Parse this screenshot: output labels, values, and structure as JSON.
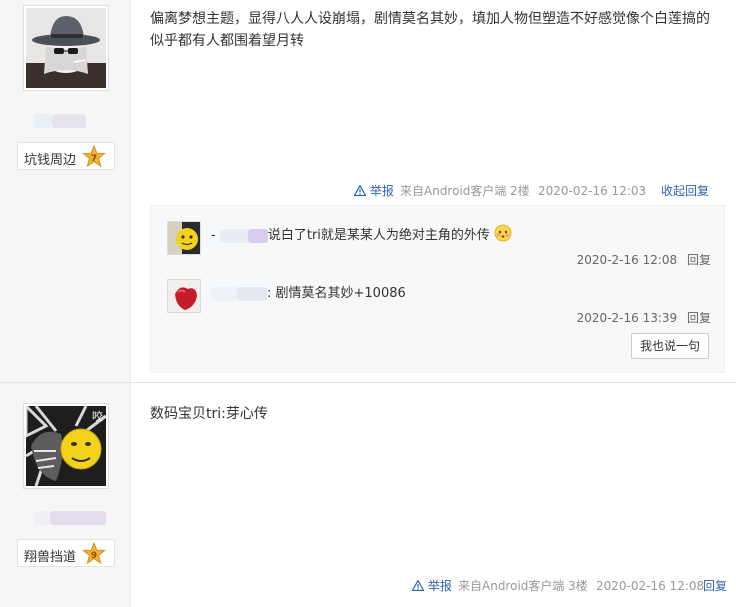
{
  "posts": [
    {
      "username_badge": "坑钱周边",
      "level": "7",
      "content": "偏离梦想主题，显得八人人设崩塌，剧情莫名其妙，填加人物但塑造不好感觉像个白莲搞的似乎都有人都围着望月转",
      "tail": {
        "report": "举报",
        "source": "来自Android客户端",
        "floor": "2楼",
        "time": "2020-02-16 12:03",
        "collapse": "收起回复"
      },
      "replies": [
        {
          "prefix": "-",
          "text": "说白了tri就是某某人为绝对主角的外传",
          "time": "2020-2-16 12:08",
          "reply": "回复"
        },
        {
          "prefix": "",
          "text": ": 剧情莫名其妙+10086",
          "time": "2020-2-16 13:39",
          "reply": "回复"
        }
      ],
      "say_button": "我也说一句"
    },
    {
      "username_badge": "翔兽挡道",
      "level": "9",
      "content": "数码宝贝tri:芽心传",
      "tail": {
        "report": "举报",
        "source": "来自Android客户端",
        "floor": "3楼",
        "time": "2020-02-16 12:08",
        "reply": "回复"
      }
    }
  ],
  "colors": {
    "link": "#2d64b3",
    "sidebar": "#f6f6f6",
    "reply_bg": "#f7f8fa",
    "badge_star": "#f3b23a"
  },
  "icons": [
    "warning-icon",
    "level-star-icon",
    "blush-emoji-icon"
  ]
}
